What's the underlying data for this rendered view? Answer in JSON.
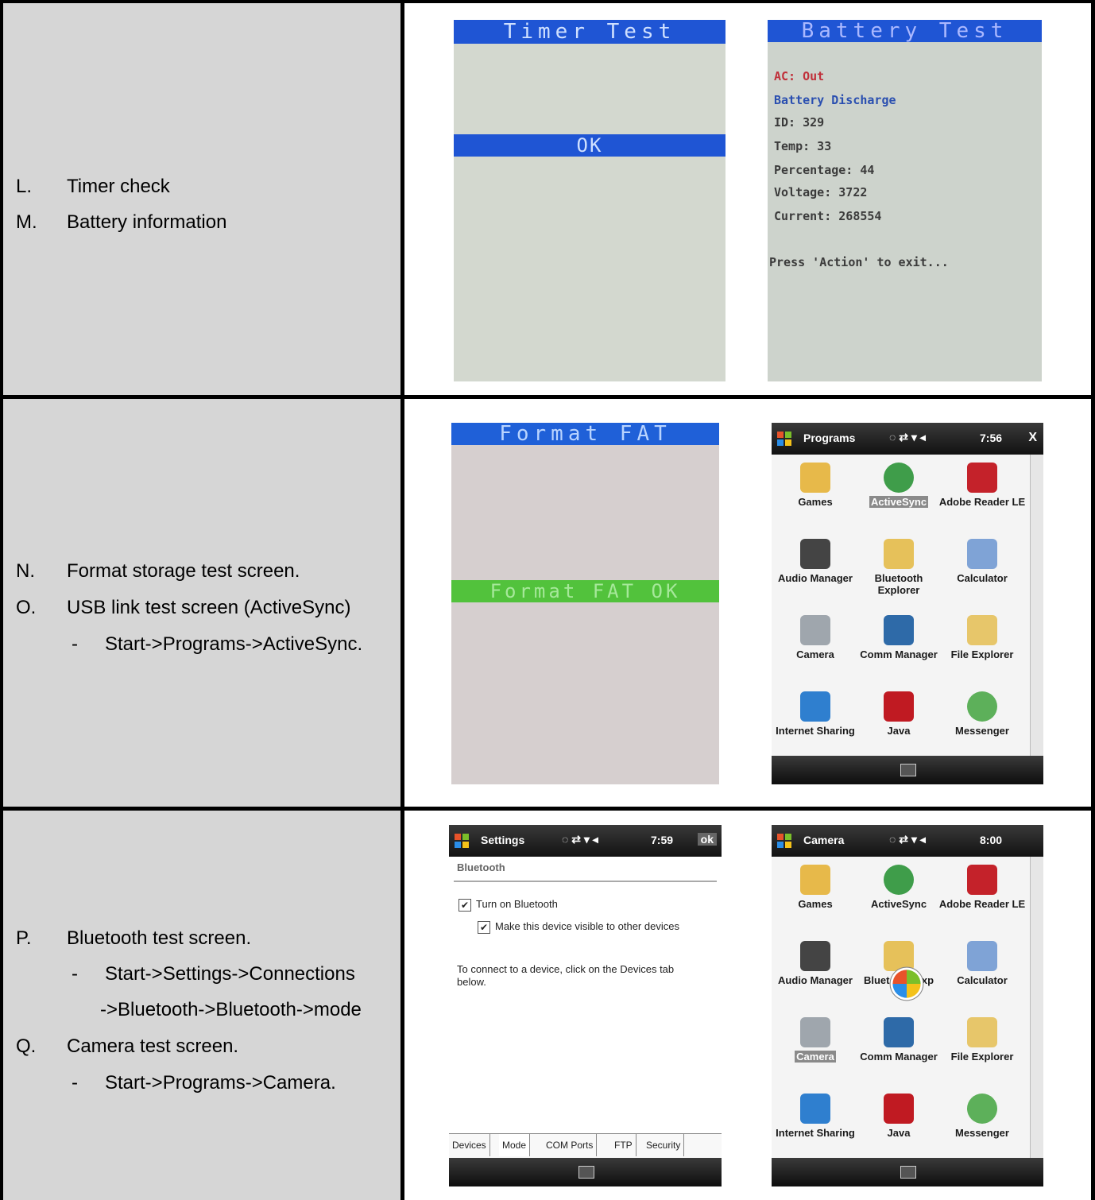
{
  "rows": [
    {
      "items": [
        {
          "label": "L.",
          "text": "Timer check"
        },
        {
          "label": "M.",
          "text": "Battery information"
        }
      ]
    },
    {
      "items": [
        {
          "label": "N.",
          "text": "Format storage test screen."
        },
        {
          "label": "O.",
          "text": "USB link test screen (ActiveSync)"
        },
        {
          "label": "-",
          "text": "Start->Programs->ActiveSync."
        }
      ]
    },
    {
      "items": [
        {
          "label": "P.",
          "text": "Bluetooth test screen."
        },
        {
          "label": "-",
          "text": "Start->Settings->Connections"
        },
        {
          "label": "",
          "text": "->Bluetooth->Bluetooth->mode"
        },
        {
          "label": "Q.",
          "text": "Camera test screen."
        },
        {
          "label": "-",
          "text": "Start->Programs->Camera."
        }
      ]
    }
  ],
  "timer_screen": {
    "title": "Timer  Test",
    "status": "OK"
  },
  "battery_screen": {
    "title": "Battery  Test",
    "ac": "AC: Out",
    "state": "Battery Discharge",
    "id": "ID: 329",
    "temp": "Temp: 33",
    "percentage": "Percentage: 44",
    "voltage": "Voltage: 3722",
    "current": "Current: 268554",
    "exit": "Press 'Action' to exit..."
  },
  "fat_screen": {
    "title": "Format  FAT",
    "status": "Format FAT OK"
  },
  "programs_screen": {
    "title": "Programs",
    "time": "7:56",
    "close": "X",
    "apps": [
      {
        "label": "Games",
        "icon": "games-icon"
      },
      {
        "label": "ActiveSync",
        "icon": "activesync-icon"
      },
      {
        "label": "Adobe Reader LE",
        "icon": "adobe-reader-icon"
      },
      {
        "label": "Audio Manager",
        "icon": "audio-manager-icon"
      },
      {
        "label": "Bluetooth Explorer",
        "icon": "bluetooth-explorer-icon"
      },
      {
        "label": "Calculator",
        "icon": "calculator-icon"
      },
      {
        "label": "Camera",
        "icon": "camera-icon"
      },
      {
        "label": "Comm Manager",
        "icon": "comm-manager-icon"
      },
      {
        "label": "File Explorer",
        "icon": "file-explorer-icon"
      },
      {
        "label": "Internet Sharing",
        "icon": "internet-sharing-icon"
      },
      {
        "label": "Java",
        "icon": "java-icon"
      },
      {
        "label": "Messenger",
        "icon": "messenger-icon"
      }
    ]
  },
  "settings_screen": {
    "title": "Settings",
    "time": "7:59",
    "ok": "ok",
    "section": "Bluetooth",
    "check1": "Turn on Bluetooth",
    "check2": "Make this device visible to other devices",
    "info": "To connect to a device, click on the Devices tab below.",
    "tabs": [
      "Devices",
      "Mode",
      "COM Ports",
      "FTP",
      "Security"
    ]
  },
  "camera_screen": {
    "title": "Camera",
    "time": "8:00",
    "apps": [
      {
        "label": "Games"
      },
      {
        "label": "ActiveSync"
      },
      {
        "label": "Adobe Reader LE"
      },
      {
        "label": "Audio Manager"
      },
      {
        "label": "Bluetooth Exp"
      },
      {
        "label": "Calculator"
      },
      {
        "label": "Camera"
      },
      {
        "label": "Comm Manager"
      },
      {
        "label": "File Explorer"
      },
      {
        "label": "Internet Sharing"
      },
      {
        "label": "Java"
      },
      {
        "label": "Messenger"
      }
    ]
  }
}
